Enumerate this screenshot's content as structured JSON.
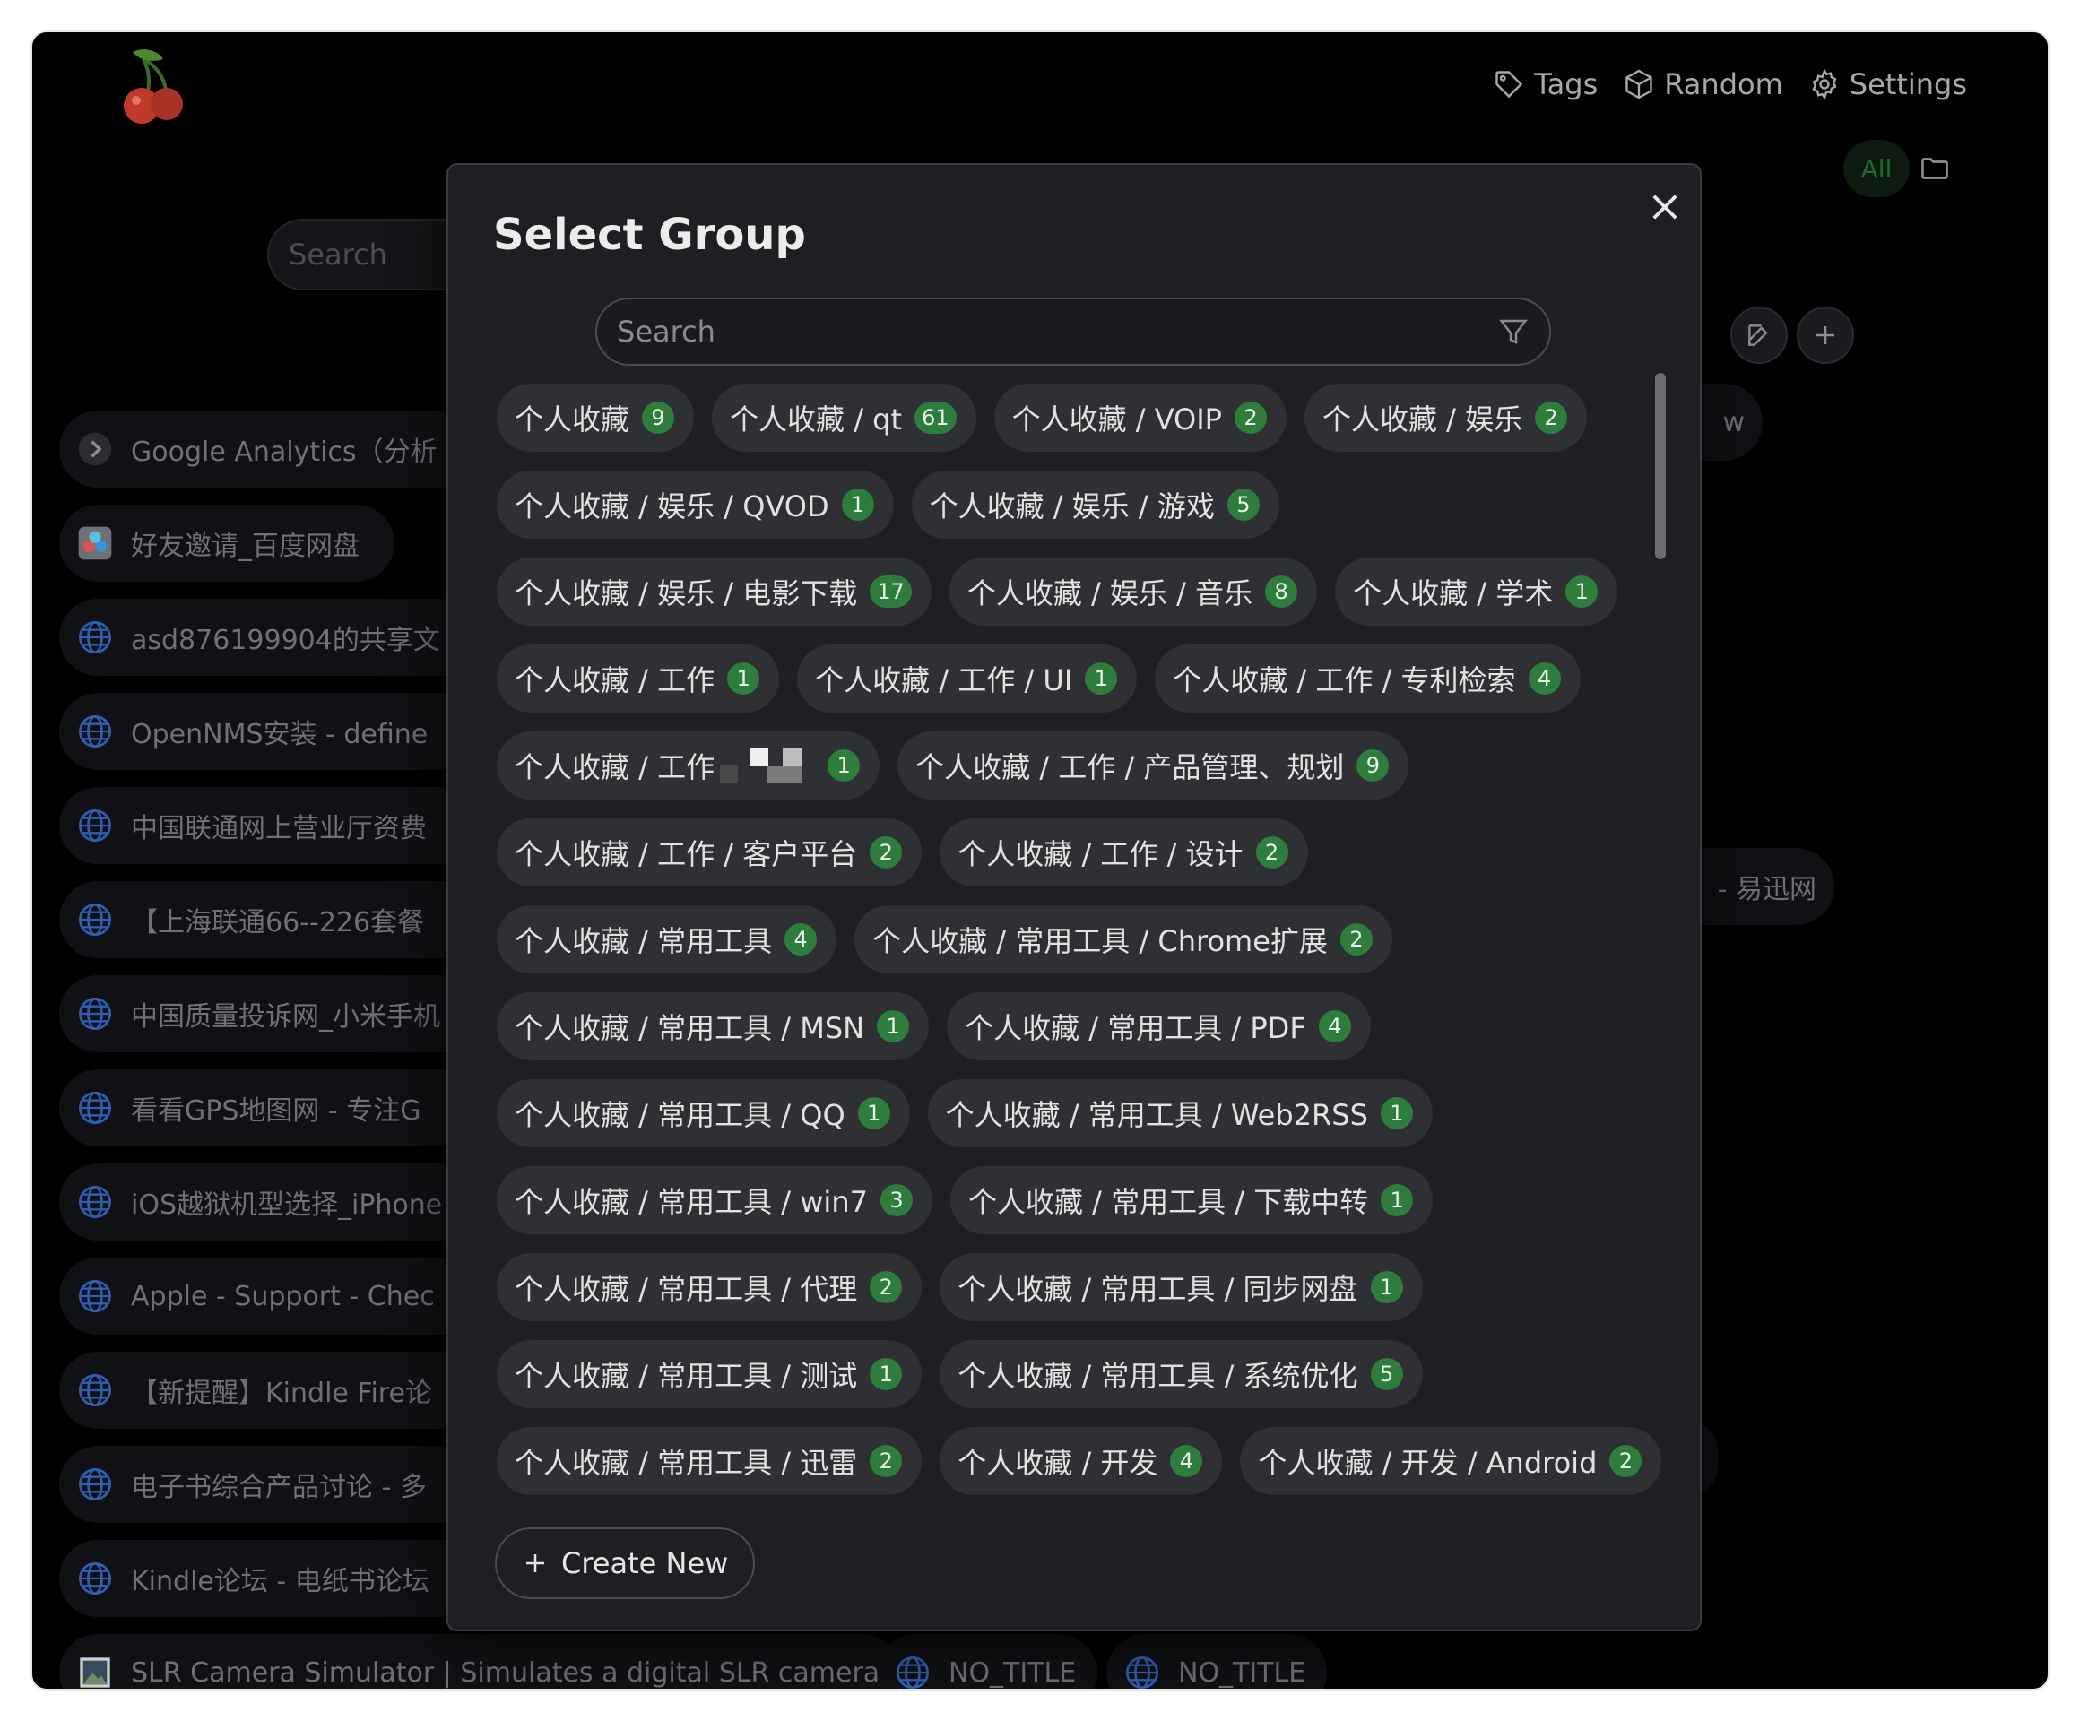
{
  "nav": {
    "tags": "Tags",
    "random": "Random",
    "settings": "Settings"
  },
  "filter": {
    "all": "All"
  },
  "bg_search_placeholder": "Search",
  "bookmarks": [
    {
      "title": "Google Analytics（分析",
      "icon": "chevron-right-icon"
    },
    {
      "title": "好友邀请_百度网盘",
      "icon": "baidu-netdisk-icon"
    },
    {
      "title": "asd876199904的共享文",
      "icon": "globe-icon"
    },
    {
      "title": "OpenNMS安装 - define",
      "icon": "globe-icon"
    },
    {
      "title": "中国联通网上营业厅资费",
      "icon": "globe-icon"
    },
    {
      "title": "【上海联通66--226套餐",
      "icon": "globe-icon"
    },
    {
      "title": "中国质量投诉网_小米手机",
      "icon": "globe-icon"
    },
    {
      "title": "看看GPS地图网 - 专注G",
      "icon": "globe-icon"
    },
    {
      "title": "iOS越狱机型选择_iPhone",
      "icon": "globe-icon"
    },
    {
      "title": "Apple - Support - Chec",
      "icon": "globe-icon"
    },
    {
      "title": "【新提醒】Kindle Fire论",
      "icon": "globe-icon"
    },
    {
      "title": "电子书综合产品讨论 - 多",
      "icon": "globe-icon"
    },
    {
      "title": "Kindle论坛 - 电纸书论坛",
      "icon": "globe-icon"
    }
  ],
  "bottom_bookmarks": [
    {
      "title": "SLR Camera Simulator | Simulates a digital SLR camera",
      "icon": "image-icon"
    },
    {
      "title": "NO_TITLE",
      "icon": "globe-icon"
    },
    {
      "title": "NO_TITLE",
      "icon": "globe-icon"
    }
  ],
  "right_fragments": {
    "row1": "w",
    "row6": "- 易迅网"
  },
  "modal": {
    "title": "Select Group",
    "search_placeholder": "Search",
    "create_new": "Create New",
    "rows": [
      [
        {
          "label": "个人收藏",
          "count": "9"
        },
        {
          "label": "个人收藏 / qt",
          "count": "61"
        },
        {
          "label": "个人收藏 / VOIP",
          "count": "2"
        },
        {
          "label": "个人收藏 / 娱乐",
          "count": "2"
        }
      ],
      [
        {
          "label": "个人收藏 / 娱乐 / QVOD",
          "count": "1"
        },
        {
          "label": "个人收藏 / 娱乐 / 游戏",
          "count": "5"
        }
      ],
      [
        {
          "label": "个人收藏 / 娱乐 / 电影下载",
          "count": "17"
        },
        {
          "label": "个人收藏 / 娱乐 / 音乐",
          "count": "8"
        },
        {
          "label": "个人收藏 / 学术",
          "count": "1"
        }
      ],
      [
        {
          "label": "个人收藏 / 工作",
          "count": "1"
        },
        {
          "label": "个人收藏 / 工作 / UI",
          "count": "1"
        },
        {
          "label": "个人收藏 / 工作 / 专利检索",
          "count": "4"
        }
      ],
      [
        {
          "label": "个人收藏 / 工作",
          "count": "1",
          "redacted": true
        },
        {
          "label": "个人收藏 / 工作 / 产品管理、规划",
          "count": "9"
        }
      ],
      [
        {
          "label": "个人收藏 / 工作 / 客户平台",
          "count": "2"
        },
        {
          "label": "个人收藏 / 工作 / 设计",
          "count": "2"
        }
      ],
      [
        {
          "label": "个人收藏 / 常用工具",
          "count": "4"
        },
        {
          "label": "个人收藏 / 常用工具 / Chrome扩展",
          "count": "2"
        }
      ],
      [
        {
          "label": "个人收藏 / 常用工具 / MSN",
          "count": "1"
        },
        {
          "label": "个人收藏 / 常用工具 / PDF",
          "count": "4"
        }
      ],
      [
        {
          "label": "个人收藏 / 常用工具 / QQ",
          "count": "1"
        },
        {
          "label": "个人收藏 / 常用工具 / Web2RSS",
          "count": "1"
        }
      ],
      [
        {
          "label": "个人收藏 / 常用工具 / win7",
          "count": "3"
        },
        {
          "label": "个人收藏 / 常用工具 / 下载中转",
          "count": "1"
        }
      ],
      [
        {
          "label": "个人收藏 / 常用工具 / 代理",
          "count": "2"
        },
        {
          "label": "个人收藏 / 常用工具 / 同步网盘",
          "count": "1"
        }
      ],
      [
        {
          "label": "个人收藏 / 常用工具 / 测试",
          "count": "1"
        },
        {
          "label": "个人收藏 / 常用工具 / 系统优化",
          "count": "5"
        }
      ],
      [
        {
          "label": "个人收藏 / 常用工具 / 迅雷",
          "count": "2"
        },
        {
          "label": "个人收藏 / 开发",
          "count": "4"
        },
        {
          "label": "个人收藏 / 开发 / Android",
          "count": "2"
        }
      ]
    ]
  },
  "colors": {
    "count_badge": "#2f7d3c",
    "chip_bg": "#2e3034",
    "modal_bg": "#1e1f22",
    "accent_green": "#1e6b34"
  }
}
